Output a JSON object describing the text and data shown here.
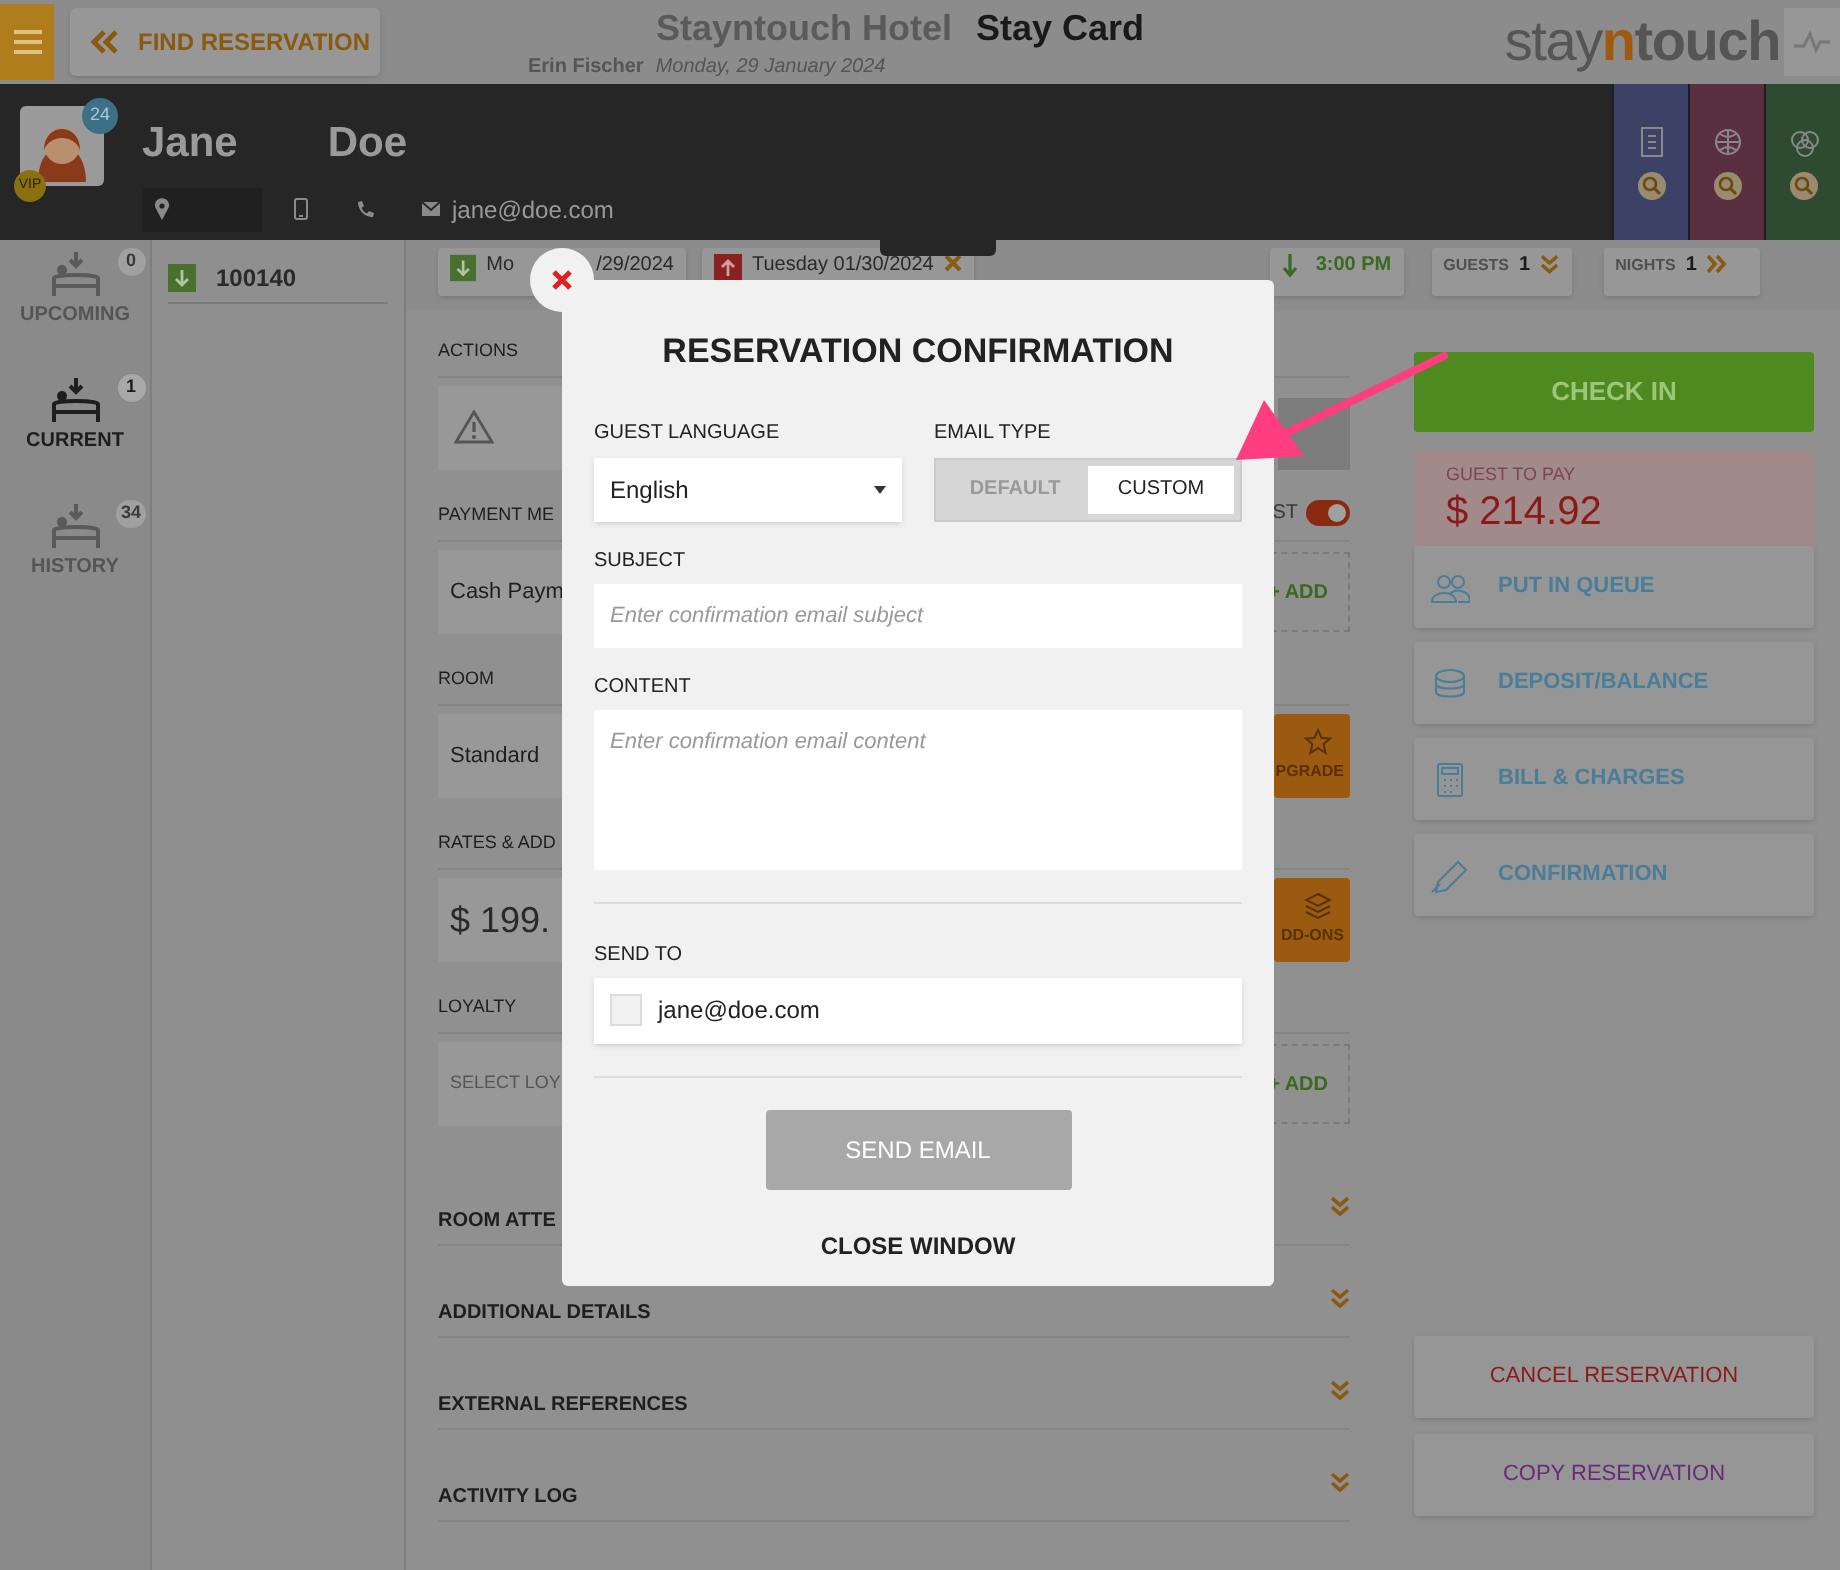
{
  "header": {
    "find_button": "FIND RESERVATION",
    "hotel": "Stayntouch Hotel",
    "page_title": "Stay Card",
    "user": "Erin Fischer",
    "date": "Monday, 29 January 2024",
    "logo": {
      "before": "stay",
      "accent": "n",
      "after": "touch"
    }
  },
  "guest": {
    "first_name": "Jane",
    "last_name": "Doe",
    "badge": "24",
    "vip": "VIP",
    "email": "jane@doe.com"
  },
  "nav": [
    {
      "label": "UPCOMING",
      "count": "0",
      "selected": false
    },
    {
      "label": "CURRENT",
      "count": "1",
      "selected": true
    },
    {
      "label": "HISTORY",
      "count": "34",
      "selected": false
    }
  ],
  "reservations": [
    {
      "number": "100140"
    }
  ],
  "stay_bar": {
    "arrival_start": "Mo",
    "arrival_end": "/29/2024",
    "departure": "Tuesday 01/30/2024",
    "time": "3:00 PM",
    "guests_label": "GUESTS",
    "guests": "1",
    "nights_label": "NIGHTS",
    "nights": "1"
  },
  "sections": [
    {
      "kind": "heading",
      "label": "ACTIONS"
    },
    {
      "kind": "alert"
    },
    {
      "kind": "heading",
      "label": "PAYMENT ME",
      "side": "ST",
      "toggle_on": true
    },
    {
      "kind": "card",
      "text": "Cash Paym",
      "action": {
        "kind": "add",
        "label": "+ ADD"
      }
    },
    {
      "kind": "heading",
      "label": "ROOM"
    },
    {
      "kind": "card",
      "text": "Standard",
      "action": {
        "kind": "upgrade",
        "label": "PGRADE"
      }
    },
    {
      "kind": "heading",
      "label": "RATES & ADD"
    },
    {
      "kind": "amount",
      "text": "$ 199.",
      "action": {
        "kind": "addons",
        "label": "DD-ONS"
      }
    },
    {
      "kind": "heading",
      "label": "LOYALTY"
    },
    {
      "kind": "placeholder",
      "text": "SELECT LOY",
      "action": {
        "kind": "add",
        "label": "+ ADD"
      }
    },
    {
      "kind": "accordion",
      "label": "ROOM ATTE"
    },
    {
      "kind": "accordion",
      "label": "ADDITIONAL DETAILS"
    },
    {
      "kind": "accordion",
      "label": "EXTERNAL REFERENCES"
    },
    {
      "kind": "accordion",
      "label": "ACTIVITY LOG"
    }
  ],
  "right_panel": {
    "check_in": "CHECK IN",
    "pay_label": "GUEST TO PAY",
    "pay_amount": "$ 214.92",
    "actions": [
      {
        "label": "PUT IN QUEUE",
        "kind": "queue"
      },
      {
        "label": "DEPOSIT/BALANCE",
        "kind": "deposit"
      },
      {
        "label": "BILL & CHARGES",
        "kind": "bill"
      },
      {
        "label": "CONFIRMATION",
        "kind": "confirmation"
      }
    ],
    "bottom": [
      {
        "label": "CANCEL RESERVATION",
        "kind": "cancel"
      },
      {
        "label": "COPY RESERVATION",
        "kind": "copy"
      }
    ]
  },
  "modal": {
    "title": "RESERVATION CONFIRMATION",
    "language_label": "GUEST LANGUAGE",
    "language": "English",
    "email_type_label": "EMAIL TYPE",
    "email_types": [
      {
        "label": "DEFAULT",
        "selected": false
      },
      {
        "label": "CUSTOM",
        "selected": true
      }
    ],
    "subject_label": "SUBJECT",
    "subject_placeholder": "Enter confirmation email subject",
    "content_label": "CONTENT",
    "content_placeholder": "Enter confirmation email content",
    "send_to_label": "SEND TO",
    "recipients": [
      {
        "email": "jane@doe.com",
        "checked": false
      }
    ],
    "send_button": {
      "label": "SEND EMAIL",
      "disabled": true
    },
    "close_label": "CLOSE WINDOW"
  }
}
